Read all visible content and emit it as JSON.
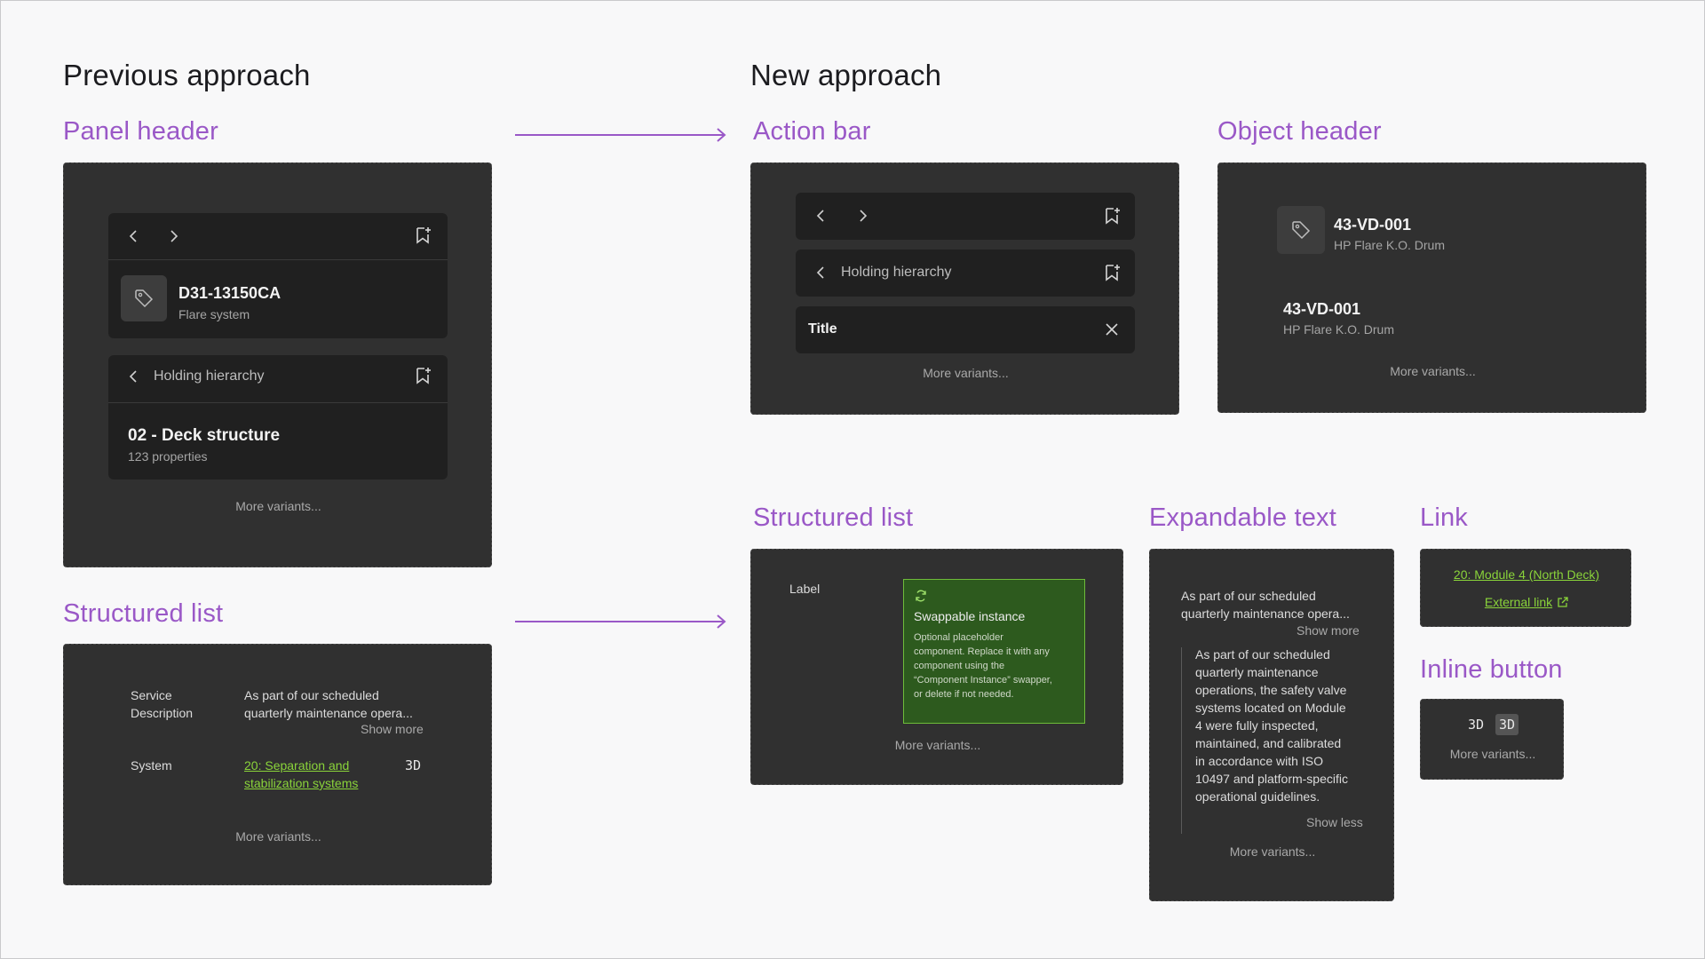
{
  "headings": {
    "previous": "Previous approach",
    "new": "New approach"
  },
  "sections": {
    "panel_header": "Panel header",
    "action_bar": "Action bar",
    "object_header": "Object header",
    "structured_list_prev": "Structured list",
    "structured_list_new": "Structured list",
    "expandable_text": "Expandable text",
    "link": "Link",
    "inline_button": "Inline button"
  },
  "panel_header": {
    "object_title": "D31-13150CA",
    "object_subtitle": "Flare system",
    "hierarchy_label": "Holding hierarchy",
    "section_title": "02 - Deck structure",
    "section_subtitle": "123 properties",
    "more": "More variants..."
  },
  "action_bar": {
    "hierarchy_label": "Holding hierarchy",
    "title_label": "Title",
    "more": "More variants..."
  },
  "object_header": {
    "title_1": "43-VD-001",
    "subtitle_1": "HP Flare K.O. Drum",
    "title_2": "43-VD-001",
    "subtitle_2": "HP Flare K.O. Drum",
    "more": "More variants..."
  },
  "structured_list_prev": {
    "row1_label_1": "Service",
    "row1_label_2": "Description",
    "row1_value_1": "As part of our scheduled",
    "row1_value_2": "quarterly maintenance opera...",
    "show_more": "Show more",
    "row2_label": "System",
    "row2_link_1": "20: Separation and",
    "row2_link_2": "stabilization systems",
    "row2_badge": "3D",
    "more": "More variants..."
  },
  "structured_list_new": {
    "label": "Label",
    "instance_title": "Swappable instance",
    "instance_lines": [
      "Optional placeholder",
      "component. Replace it with any",
      "component using the",
      "“Component Instance” swapper,",
      "or delete if not needed."
    ],
    "more": "More variants..."
  },
  "expandable_text": {
    "collapsed_1": "As part of our scheduled",
    "collapsed_2": "quarterly maintenance opera...",
    "show_more": "Show more",
    "expanded_lines": [
      "As part of our scheduled",
      "quarterly maintenance",
      "operations, the safety valve",
      "systems located on Module",
      "4 were fully inspected,",
      "maintained, and calibrated",
      "in accordance with ISO",
      "10497 and platform-specific",
      "operational guidelines."
    ],
    "show_less": "Show less",
    "more": "More variants..."
  },
  "link": {
    "internal": "20: Module 4 (North Deck)",
    "external": "External link"
  },
  "inline_button": {
    "badge_1": "3D",
    "badge_2": "3D",
    "more": "More variants..."
  },
  "colors": {
    "accent_purple": "#9a58c7",
    "card_bg": "#303030",
    "sub_bg": "#202020",
    "link_green": "#8ad43a",
    "instance_green": "#2d5a1e"
  },
  "icons": [
    "chevron-left-icon",
    "chevron-right-icon",
    "bookmark-add-icon",
    "tag-icon",
    "close-icon",
    "refresh-icon",
    "external-link-icon",
    "arrow-right-icon"
  ]
}
